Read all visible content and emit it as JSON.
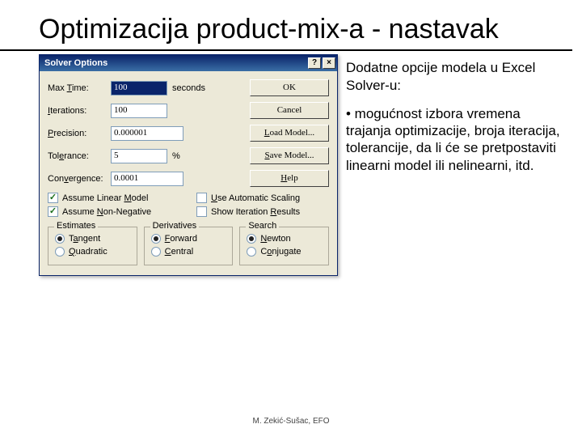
{
  "title": "Optimizacija product-mix-a - nastavak",
  "dialog": {
    "title": "Solver Options",
    "help_glyph": "?",
    "close_glyph": "×",
    "rows": {
      "max_time_label": "Max Time:",
      "max_time_u": "T",
      "max_time_value": "100",
      "max_time_unit": "seconds",
      "iterations_label": "Iterations:",
      "iterations_u": "I",
      "iterations_value": "100",
      "precision_label": "Precision:",
      "precision_u": "P",
      "precision_value": "0.000001",
      "tolerance_label": "Tolerance:",
      "tolerance_u": "e",
      "tolerance_value": "5",
      "tolerance_unit": "%",
      "convergence_label": "Convergence:",
      "convergence_u": "v",
      "convergence_value": "0.0001"
    },
    "buttons": {
      "ok": "OK",
      "cancel": "Cancel",
      "load": "Load Model...",
      "save": "Save Model...",
      "help": "Help"
    },
    "checks": {
      "linear": "Assume Linear Model",
      "linear_u": "M",
      "nonneg": "Assume Non-Negative",
      "nonneg_u": "N",
      "autoscale": "Use Automatic Scaling",
      "autoscale_u": "U",
      "showiter": "Show Iteration Results",
      "showiter_u": "R",
      "linear_on": "✓",
      "nonneg_on": "✓"
    },
    "groups": {
      "estimates": "Estimates",
      "tangent": "Tangent",
      "tangent_u": "a",
      "quadratic": "Quadratic",
      "quadratic_u": "Q",
      "derivatives": "Derivatives",
      "forward": "Forward",
      "forward_u": "F",
      "central": "Central",
      "central_u": "C",
      "search": "Search",
      "newton": "Newton",
      "newton_u": "N",
      "conjugate": "Conjugate",
      "conjugate_u": "o"
    }
  },
  "right": {
    "p1": "Dodatne opcije modela u Excel Solver-u:",
    "p2": "• mogućnost izbora vremena trajanja optimizacije, broja iteracija, tolerancije, da li će se pretpostaviti linearni model ili nelinearni, itd."
  },
  "footer": "M. Zekić-Sušac, EFO"
}
